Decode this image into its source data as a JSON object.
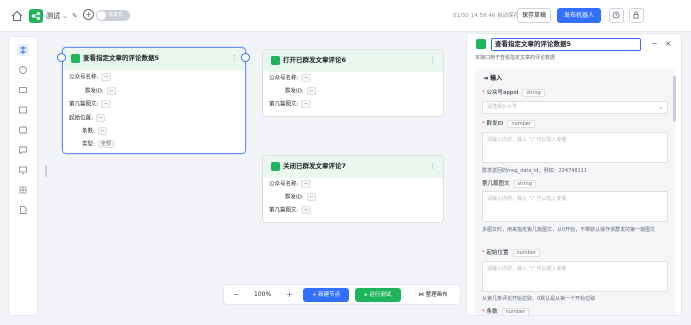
{
  "topbar": {
    "app_name": "测试",
    "toggle_label": "未发布",
    "saved_status": "01/30 14:59:46 自动保存草稿",
    "save_draft": "保存草稿",
    "publish": "发布机器人"
  },
  "nodes": [
    {
      "title": "查看指定文章的评论数据5",
      "fields": [
        {
          "label": "公众号名称:",
          "value": "--"
        },
        {
          "label": "群发ID:",
          "value": "--"
        },
        {
          "label": "第几篇图文:",
          "value": "--"
        },
        {
          "label": "起始位置:",
          "value": "--"
        },
        {
          "label": "条数:",
          "value": "--"
        },
        {
          "label": "类型:",
          "value": "全部"
        }
      ]
    },
    {
      "title": "打开已群发文章评论6",
      "fields": [
        {
          "label": "公众号名称:",
          "value": "--"
        },
        {
          "label": "群发ID:",
          "value": "--"
        },
        {
          "label": "第几篇图文:",
          "value": "--"
        }
      ]
    },
    {
      "title": "关闭已群发文章评论7",
      "fields": [
        {
          "label": "公众号名称:",
          "value": "--"
        },
        {
          "label": "群发ID:",
          "value": "--"
        },
        {
          "label": "第几篇图文:",
          "value": "--"
        }
      ]
    }
  ],
  "bottombar": {
    "zoom": "100%",
    "add_node": "新建节点",
    "run_test": "运行测试",
    "arrange": "整理画布"
  },
  "panel": {
    "title": "查看指定文章的评论数据5",
    "description": "本接口用于查看指定文章的评论数据",
    "section": "输入",
    "fields": [
      {
        "label": "公众号appid",
        "type": "string",
        "placeholder": "请选择公众号"
      },
      {
        "label": "群发ID",
        "type": "number",
        "placeholder": "请输入内容，输入 \"/\" 可以插入变量",
        "hint": "群发返回的msg_data_id，例如：224748111"
      },
      {
        "label": "第几篇图文",
        "type": "string",
        "placeholder": "请输入内容，输入 \"/\" 可以插入变量",
        "hint": "多图文时，用来指定第几篇图文，从0开始，不带默认操作该群发的第一篇图文"
      },
      {
        "label": "起始位置",
        "type": "number",
        "placeholder": "请输入内容，输入 \"/\" 可以插入变量",
        "hint": "从第几条评论开始拉取，0默认是从第一个开始拉取"
      },
      {
        "label": "条数",
        "type": "number"
      }
    ]
  },
  "colors": {
    "accent": "#3370ff",
    "brand_green": "#1fb35b",
    "node_header": "#eaf7ee",
    "required": "#f54a45"
  },
  "icons": [
    "home-icon",
    "app-icon",
    "chevron-down-icon",
    "edit-icon",
    "add-circle-icon",
    "history-icon",
    "lock-icon",
    "more-icon",
    "minimize-icon",
    "close-icon",
    "input-icon",
    "arrange-icon",
    "play-icon"
  ]
}
